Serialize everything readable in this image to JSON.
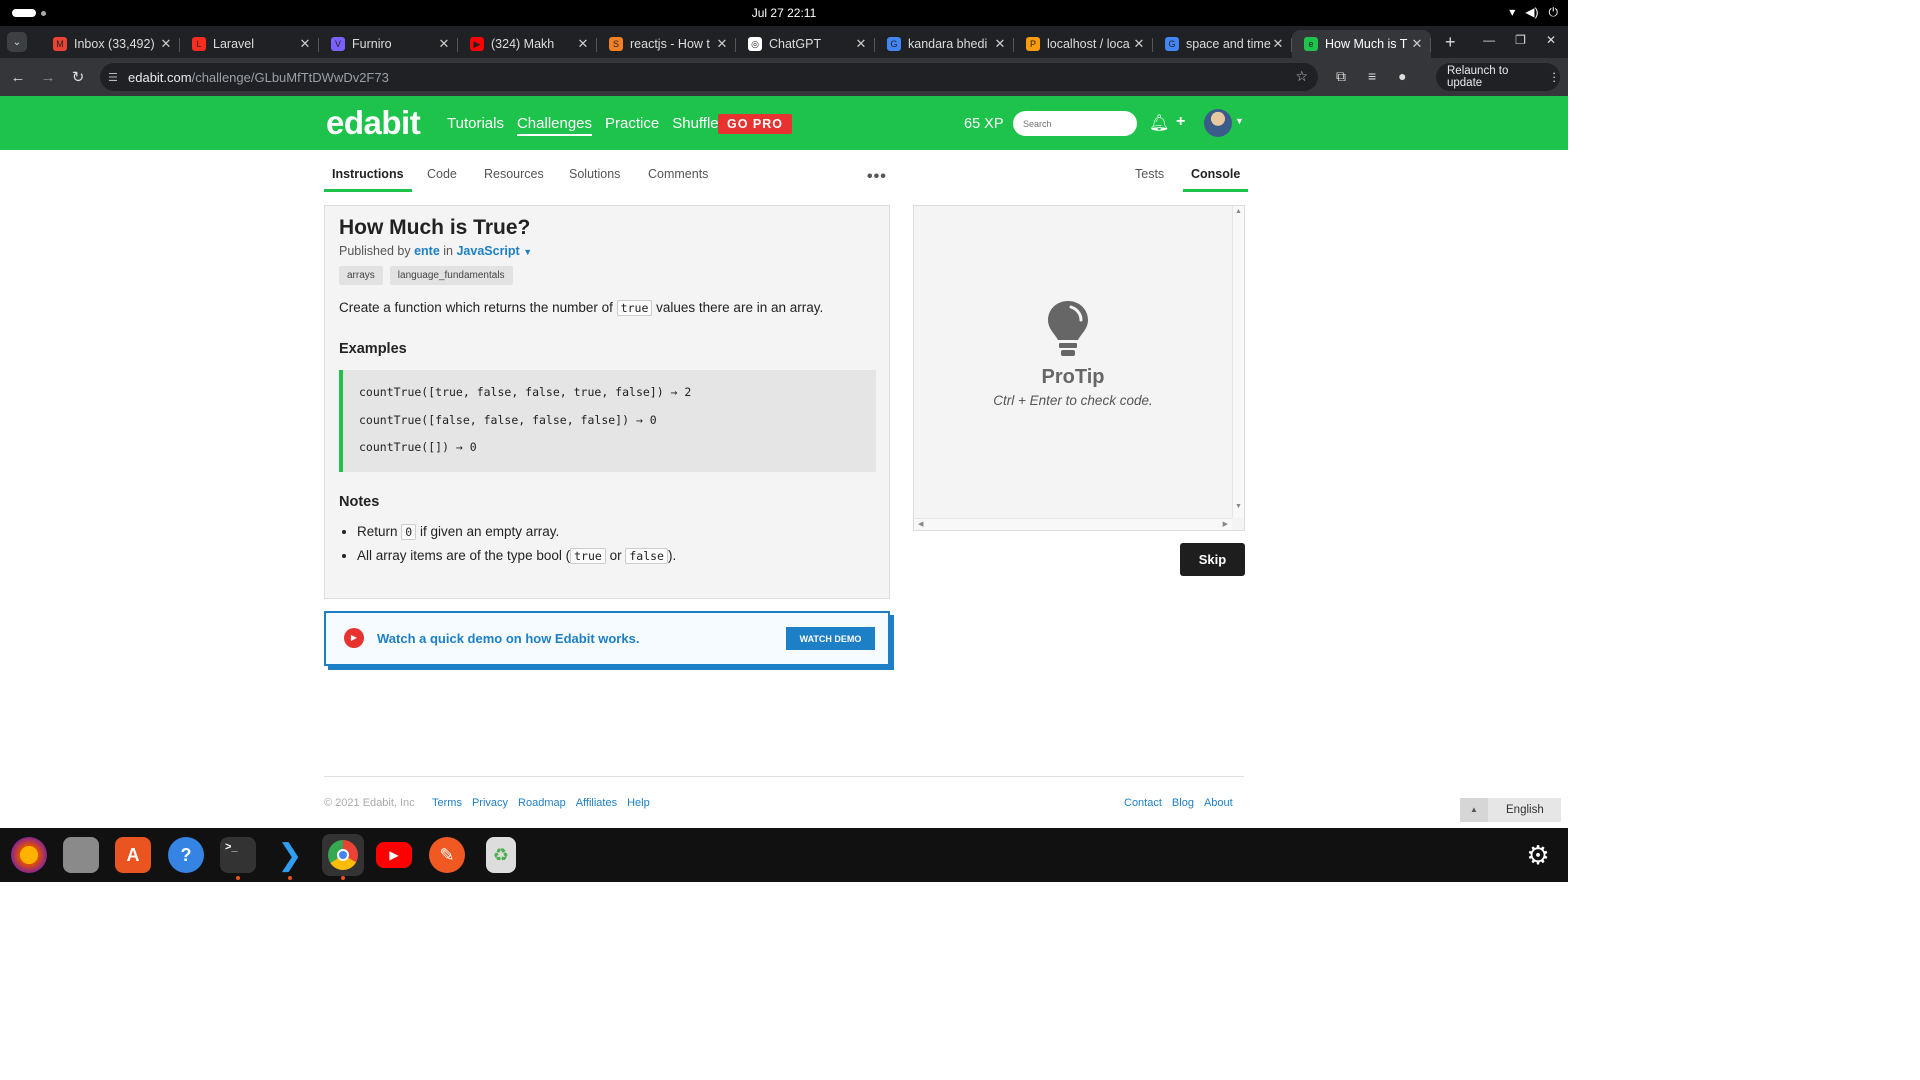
{
  "system": {
    "clock": "Jul 27  22:11"
  },
  "tabs": [
    {
      "title": "Inbox (33,492)",
      "color": "#ea4335",
      "glyph": "M"
    },
    {
      "title": "Laravel",
      "color": "#ff2d20",
      "glyph": "L"
    },
    {
      "title": "Furniro",
      "color": "#7b61ff",
      "glyph": "V"
    },
    {
      "title": "(324) Makh",
      "color": "#ff0000",
      "glyph": "▶"
    },
    {
      "title": "reactjs - How t",
      "color": "#f48024",
      "glyph": "S"
    },
    {
      "title": "ChatGPT",
      "color": "#ffffff",
      "glyph": "◎"
    },
    {
      "title": "kandara bhedi",
      "color": "#4285f4",
      "glyph": "G"
    },
    {
      "title": "localhost / loca",
      "color": "#f89c0e",
      "glyph": "P"
    },
    {
      "title": "space and time",
      "color": "#4285f4",
      "glyph": "G"
    },
    {
      "title": "How Much is T",
      "color": "#1ec34b",
      "glyph": "e"
    }
  ],
  "address": {
    "domain": "edabit.com",
    "path": "/challenge/GLbuMfTtDWwDv2F73",
    "relaunch": "Relaunch to update"
  },
  "header": {
    "logo": "edabit",
    "nav": [
      "Tutorials",
      "Challenges",
      "Practice",
      "Shuffle"
    ],
    "gopro": "GO PRO",
    "xp": "65 XP",
    "search_placeholder": "Search"
  },
  "subtabs": [
    "Instructions",
    "Code",
    "Resources",
    "Solutions",
    "Comments"
  ],
  "console_tabs": [
    "Tests",
    "Console"
  ],
  "challenge": {
    "title": "How Much is True?",
    "published_by": "Published by",
    "author": "ente",
    "in": "in",
    "language": "JavaScript",
    "tags": [
      "arrays",
      "language_fundamentals"
    ],
    "desc_pre": "Create a function which returns the number of",
    "desc_code": "true",
    "desc_post": "values there are in an array.",
    "examples_heading": "Examples",
    "examples": [
      "countTrue([true, false, false, true, false]) → 2",
      "countTrue([false, false, false, false]) → 0",
      "countTrue([]) → 0"
    ],
    "notes_heading": "Notes",
    "note1_pre": "Return",
    "note1_code": "0",
    "note1_post": "if given an empty array.",
    "note2_pre": "All array items are of the type bool (",
    "note2_code1": "true",
    "note2_mid": "or",
    "note2_code2": "false",
    "note2_post": ")."
  },
  "demo": {
    "text": "Watch a quick demo on how Edabit works.",
    "button": "WATCH DEMO"
  },
  "console": {
    "protip": "ProTip",
    "hint": "Ctrl + Enter to check code.",
    "skip": "Skip"
  },
  "footer": {
    "copyright": "© 2021 Edabit, Inc",
    "left_links": [
      "Terms",
      "Privacy",
      "Roadmap",
      "Affiliates",
      "Help"
    ],
    "right_links": [
      "Contact",
      "Blog",
      "About"
    ],
    "language": "English"
  },
  "colors": {
    "brand_green": "#1ec34b",
    "link_blue": "#1d7fc5",
    "gopro_red": "#e7322f"
  }
}
